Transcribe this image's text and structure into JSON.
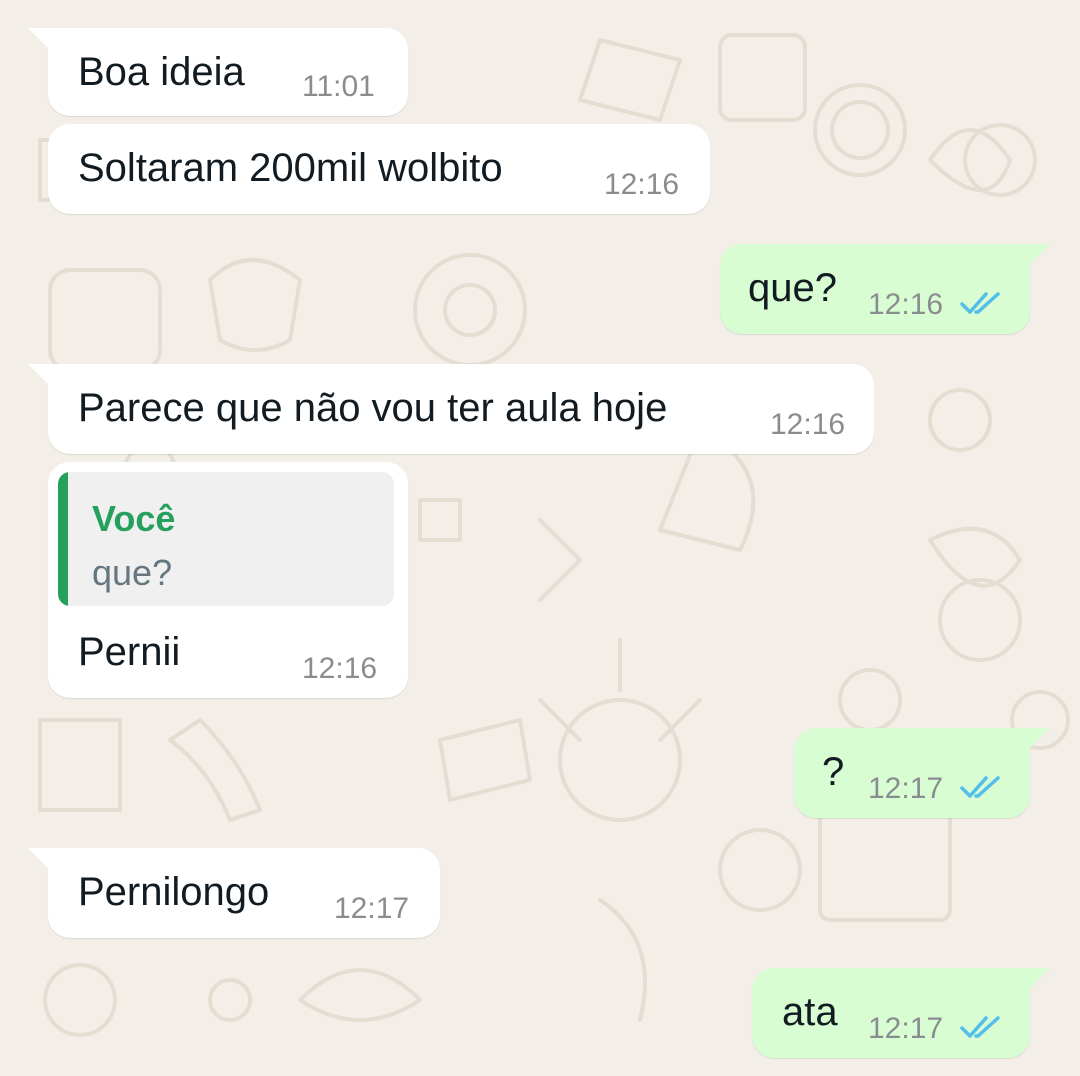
{
  "colors": {
    "background": "#f3efe8",
    "incoming_bubble": "#ffffff",
    "outgoing_bubble": "#d9fdd3",
    "read_ticks": "#53bdeb",
    "quote_accent": "#25a05d"
  },
  "messages": [
    {
      "direction": "incoming",
      "text": "Boa ideia",
      "time": "11:01"
    },
    {
      "direction": "incoming",
      "text": "Soltaram 200mil wolbito",
      "time": "12:16"
    },
    {
      "direction": "outgoing",
      "text": "que?",
      "time": "12:16",
      "status": "read"
    },
    {
      "direction": "incoming",
      "text": "Parece que não vou ter aula hoje",
      "time": "12:16"
    },
    {
      "direction": "incoming",
      "quoted": {
        "author": "Você",
        "text": "que?"
      },
      "text": "Pernii",
      "time": "12:16"
    },
    {
      "direction": "outgoing",
      "text": "?",
      "time": "12:17",
      "status": "read"
    },
    {
      "direction": "incoming",
      "text": "Pernilongo",
      "time": "12:17"
    },
    {
      "direction": "outgoing",
      "text": "ata",
      "time": "12:17",
      "status": "read"
    }
  ]
}
